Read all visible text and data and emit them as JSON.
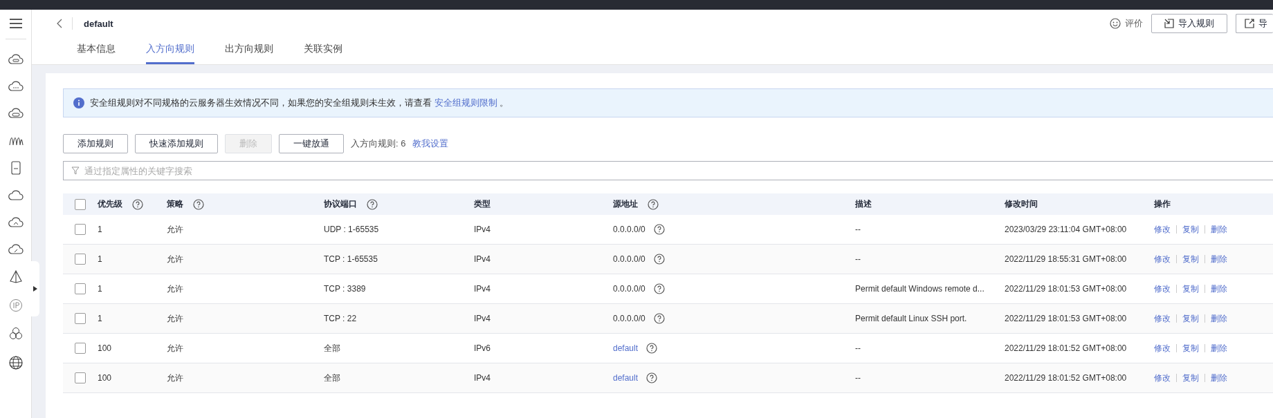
{
  "header": {
    "title": "default",
    "feedback": "评价",
    "buttons": [
      {
        "label": "导入规则",
        "kind": "import"
      },
      {
        "label": "导",
        "kind": "export"
      }
    ]
  },
  "tabs": [
    {
      "label": "基本信息",
      "selected": false
    },
    {
      "label": "入方向规则",
      "selected": true
    },
    {
      "label": "出方向规则",
      "selected": false
    },
    {
      "label": "关联实例",
      "selected": false
    }
  ],
  "notice": {
    "text": "安全组规则对不同规格的云服务器生效情况不同，如果您的安全组规则未生效，请查看",
    "link": "安全组规则限制",
    "suffix": "。"
  },
  "toolbar": {
    "buttons": [
      {
        "label": "添加规则",
        "disabled": false
      },
      {
        "label": "快速添加规则",
        "disabled": false
      },
      {
        "label": "删除",
        "disabled": true
      },
      {
        "label": "一键放通",
        "disabled": false
      }
    ],
    "count": "入方向规则: 6",
    "help_link": "教我设置"
  },
  "search": {
    "placeholder": "通过指定属性的关键字搜索"
  },
  "table": {
    "all_checked": false,
    "columns": [
      {
        "label": "优先级",
        "help": true
      },
      {
        "label": "策略",
        "help": true
      },
      {
        "label": "协议端口",
        "help": true
      },
      {
        "label": "类型",
        "help": false
      },
      {
        "label": "源地址",
        "help": true
      },
      {
        "label": "描述",
        "help": false
      },
      {
        "label": "修改时间",
        "help": false
      },
      {
        "label": "操作",
        "help": false
      }
    ],
    "rows": [
      {
        "checked": false,
        "priority": "1",
        "policy": "允许",
        "protocol_port": "UDP : 1-65535",
        "type": "IPv4",
        "source": "0.0.0.0/0",
        "source_link": false,
        "description": "--",
        "modified": "2023/03/29 23:11:04 GMT+08:00",
        "operations": [
          "修改",
          "复制",
          "删除"
        ]
      },
      {
        "checked": false,
        "priority": "1",
        "policy": "允许",
        "protocol_port": "TCP : 1-65535",
        "type": "IPv4",
        "source": "0.0.0.0/0",
        "source_link": false,
        "description": "--",
        "modified": "2022/11/29 18:55:31 GMT+08:00",
        "operations": [
          "修改",
          "复制",
          "删除"
        ]
      },
      {
        "checked": false,
        "priority": "1",
        "policy": "允许",
        "protocol_port": "TCP : 3389",
        "type": "IPv4",
        "source": "0.0.0.0/0",
        "source_link": false,
        "description": "Permit default Windows remote d...",
        "modified": "2022/11/29 18:01:53 GMT+08:00",
        "operations": [
          "修改",
          "复制",
          "删除"
        ]
      },
      {
        "checked": false,
        "priority": "1",
        "policy": "允许",
        "protocol_port": "TCP : 22",
        "type": "IPv4",
        "source": "0.0.0.0/0",
        "source_link": false,
        "description": "Permit default Linux SSH port.",
        "modified": "2022/11/29 18:01:53 GMT+08:00",
        "operations": [
          "修改",
          "复制",
          "删除"
        ]
      },
      {
        "checked": false,
        "priority": "100",
        "policy": "允许",
        "protocol_port": "全部",
        "type": "IPv6",
        "source": "default",
        "source_link": true,
        "description": "--",
        "modified": "2022/11/29 18:01:52 GMT+08:00",
        "operations": [
          "修改",
          "复制",
          "删除"
        ]
      },
      {
        "checked": false,
        "priority": "100",
        "policy": "允许",
        "protocol_port": "全部",
        "type": "IPv4",
        "source": "default",
        "source_link": true,
        "description": "--",
        "modified": "2022/11/29 18:01:52 GMT+08:00",
        "operations": [
          "修改",
          "复制",
          "删除"
        ]
      }
    ]
  }
}
